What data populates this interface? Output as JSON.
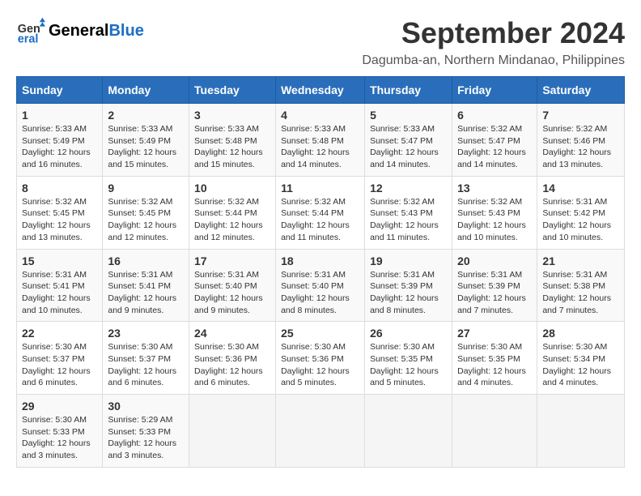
{
  "header": {
    "logo_general": "General",
    "logo_blue": "Blue",
    "month_title": "September 2024",
    "location": "Dagumba-an, Northern Mindanao, Philippines"
  },
  "calendar": {
    "days_of_week": [
      "Sunday",
      "Monday",
      "Tuesday",
      "Wednesday",
      "Thursday",
      "Friday",
      "Saturday"
    ],
    "weeks": [
      [
        null,
        {
          "day": "2",
          "sunrise": "Sunrise: 5:33 AM",
          "sunset": "Sunset: 5:49 PM",
          "daylight": "Daylight: 12 hours and 15 minutes."
        },
        {
          "day": "3",
          "sunrise": "Sunrise: 5:33 AM",
          "sunset": "Sunset: 5:48 PM",
          "daylight": "Daylight: 12 hours and 15 minutes."
        },
        {
          "day": "4",
          "sunrise": "Sunrise: 5:33 AM",
          "sunset": "Sunset: 5:48 PM",
          "daylight": "Daylight: 12 hours and 14 minutes."
        },
        {
          "day": "5",
          "sunrise": "Sunrise: 5:33 AM",
          "sunset": "Sunset: 5:47 PM",
          "daylight": "Daylight: 12 hours and 14 minutes."
        },
        {
          "day": "6",
          "sunrise": "Sunrise: 5:32 AM",
          "sunset": "Sunset: 5:47 PM",
          "daylight": "Daylight: 12 hours and 14 minutes."
        },
        {
          "day": "7",
          "sunrise": "Sunrise: 5:32 AM",
          "sunset": "Sunset: 5:46 PM",
          "daylight": "Daylight: 12 hours and 13 minutes."
        }
      ],
      [
        {
          "day": "1",
          "sunrise": "Sunrise: 5:33 AM",
          "sunset": "Sunset: 5:49 PM",
          "daylight": "Daylight: 12 hours and 16 minutes."
        },
        {
          "day": "9",
          "sunrise": "Sunrise: 5:32 AM",
          "sunset": "Sunset: 5:45 PM",
          "daylight": "Daylight: 12 hours and 12 minutes."
        },
        {
          "day": "10",
          "sunrise": "Sunrise: 5:32 AM",
          "sunset": "Sunset: 5:44 PM",
          "daylight": "Daylight: 12 hours and 12 minutes."
        },
        {
          "day": "11",
          "sunrise": "Sunrise: 5:32 AM",
          "sunset": "Sunset: 5:44 PM",
          "daylight": "Daylight: 12 hours and 11 minutes."
        },
        {
          "day": "12",
          "sunrise": "Sunrise: 5:32 AM",
          "sunset": "Sunset: 5:43 PM",
          "daylight": "Daylight: 12 hours and 11 minutes."
        },
        {
          "day": "13",
          "sunrise": "Sunrise: 5:32 AM",
          "sunset": "Sunset: 5:43 PM",
          "daylight": "Daylight: 12 hours and 10 minutes."
        },
        {
          "day": "14",
          "sunrise": "Sunrise: 5:31 AM",
          "sunset": "Sunset: 5:42 PM",
          "daylight": "Daylight: 12 hours and 10 minutes."
        }
      ],
      [
        {
          "day": "8",
          "sunrise": "Sunrise: 5:32 AM",
          "sunset": "Sunset: 5:45 PM",
          "daylight": "Daylight: 12 hours and 13 minutes."
        },
        {
          "day": "16",
          "sunrise": "Sunrise: 5:31 AM",
          "sunset": "Sunset: 5:41 PM",
          "daylight": "Daylight: 12 hours and 9 minutes."
        },
        {
          "day": "17",
          "sunrise": "Sunrise: 5:31 AM",
          "sunset": "Sunset: 5:40 PM",
          "daylight": "Daylight: 12 hours and 9 minutes."
        },
        {
          "day": "18",
          "sunrise": "Sunrise: 5:31 AM",
          "sunset": "Sunset: 5:40 PM",
          "daylight": "Daylight: 12 hours and 8 minutes."
        },
        {
          "day": "19",
          "sunrise": "Sunrise: 5:31 AM",
          "sunset": "Sunset: 5:39 PM",
          "daylight": "Daylight: 12 hours and 8 minutes."
        },
        {
          "day": "20",
          "sunrise": "Sunrise: 5:31 AM",
          "sunset": "Sunset: 5:39 PM",
          "daylight": "Daylight: 12 hours and 7 minutes."
        },
        {
          "day": "21",
          "sunrise": "Sunrise: 5:31 AM",
          "sunset": "Sunset: 5:38 PM",
          "daylight": "Daylight: 12 hours and 7 minutes."
        }
      ],
      [
        {
          "day": "15",
          "sunrise": "Sunrise: 5:31 AM",
          "sunset": "Sunset: 5:41 PM",
          "daylight": "Daylight: 12 hours and 10 minutes."
        },
        {
          "day": "23",
          "sunrise": "Sunrise: 5:30 AM",
          "sunset": "Sunset: 5:37 PM",
          "daylight": "Daylight: 12 hours and 6 minutes."
        },
        {
          "day": "24",
          "sunrise": "Sunrise: 5:30 AM",
          "sunset": "Sunset: 5:36 PM",
          "daylight": "Daylight: 12 hours and 6 minutes."
        },
        {
          "day": "25",
          "sunrise": "Sunrise: 5:30 AM",
          "sunset": "Sunset: 5:36 PM",
          "daylight": "Daylight: 12 hours and 5 minutes."
        },
        {
          "day": "26",
          "sunrise": "Sunrise: 5:30 AM",
          "sunset": "Sunset: 5:35 PM",
          "daylight": "Daylight: 12 hours and 5 minutes."
        },
        {
          "day": "27",
          "sunrise": "Sunrise: 5:30 AM",
          "sunset": "Sunset: 5:35 PM",
          "daylight": "Daylight: 12 hours and 4 minutes."
        },
        {
          "day": "28",
          "sunrise": "Sunrise: 5:30 AM",
          "sunset": "Sunset: 5:34 PM",
          "daylight": "Daylight: 12 hours and 4 minutes."
        }
      ],
      [
        {
          "day": "22",
          "sunrise": "Sunrise: 5:30 AM",
          "sunset": "Sunset: 5:37 PM",
          "daylight": "Daylight: 12 hours and 6 minutes."
        },
        {
          "day": "30",
          "sunrise": "Sunrise: 5:29 AM",
          "sunset": "Sunset: 5:33 PM",
          "daylight": "Daylight: 12 hours and 3 minutes."
        },
        null,
        null,
        null,
        null,
        null
      ],
      [
        {
          "day": "29",
          "sunrise": "Sunrise: 5:30 AM",
          "sunset": "Sunset: 5:33 PM",
          "daylight": "Daylight: 12 hours and 3 minutes."
        },
        null,
        null,
        null,
        null,
        null,
        null
      ]
    ]
  }
}
